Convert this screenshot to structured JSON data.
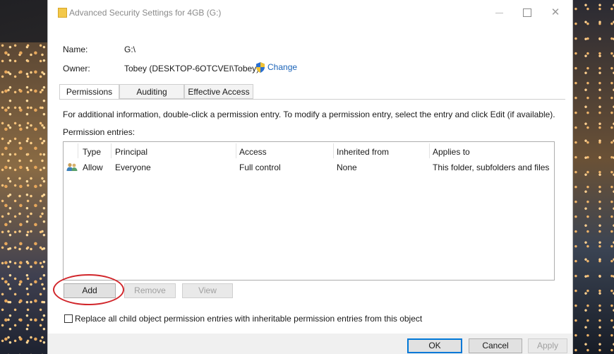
{
  "window": {
    "title": "Advanced Security Settings for 4GB (G:)"
  },
  "info": {
    "name_label": "Name:",
    "name_value": "G:\\",
    "owner_label": "Owner:",
    "owner_value": "Tobey (DESKTOP-6OTCVEI\\Tobey)",
    "change_link": "Change"
  },
  "tabs": [
    {
      "label": "Permissions",
      "active": true
    },
    {
      "label": "Auditing",
      "active": false
    },
    {
      "label": "Effective Access",
      "active": false
    }
  ],
  "permissions": {
    "info_text": "For additional information, double-click a permission entry. To modify a permission entry, select the entry and click Edit (if available).",
    "entries_label": "Permission entries:",
    "columns": [
      "Type",
      "Principal",
      "Access",
      "Inherited from",
      "Applies to"
    ],
    "rows": [
      {
        "icon": "users-icon",
        "type": "Allow",
        "principal": "Everyone",
        "access": "Full control",
        "inherited": "None",
        "applies": "This folder, subfolders and files"
      }
    ]
  },
  "buttons": {
    "add": "Add",
    "remove": "Remove",
    "view": "View",
    "ok": "OK",
    "cancel": "Cancel",
    "apply": "Apply"
  },
  "replace_checkbox": {
    "label": "Replace all child object permission entries with inheritable permission entries from this object",
    "checked": false
  },
  "colors": {
    "highlight": "#d1262b",
    "link": "#1a63b8",
    "focus": "#0078d7"
  }
}
